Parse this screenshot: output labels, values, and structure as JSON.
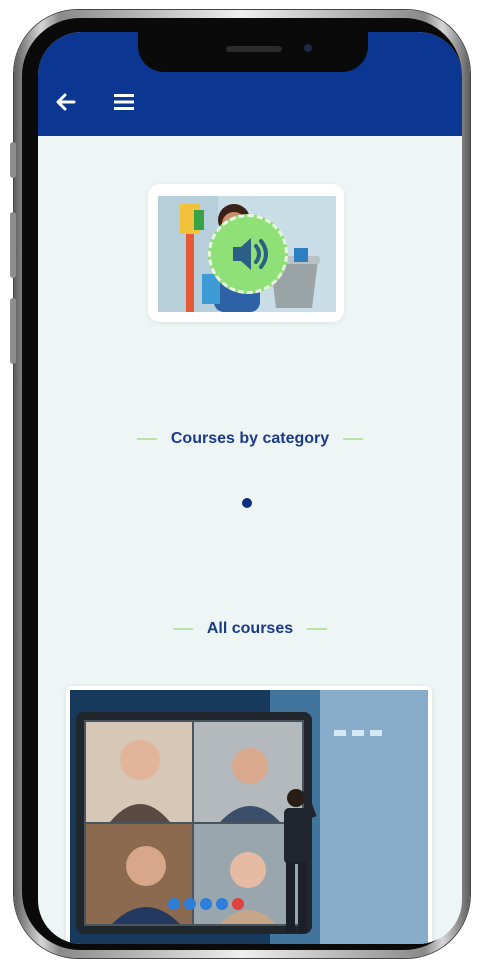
{
  "nav": {
    "back_icon": "arrow-left-icon",
    "menu_icon": "hamburger-menu-icon"
  },
  "hero": {
    "image": "person-with-cleaning-supplies",
    "audio_icon": "speaker-volume-icon"
  },
  "sections": {
    "category_title": "Courses by category",
    "all_courses_title": "All courses"
  },
  "course": {
    "image": "video-conference-screen"
  },
  "colors": {
    "topbar": "#0b3691",
    "background": "#eef6f5",
    "accent_green": "#8fe076",
    "title_text": "#1b3a8a"
  }
}
